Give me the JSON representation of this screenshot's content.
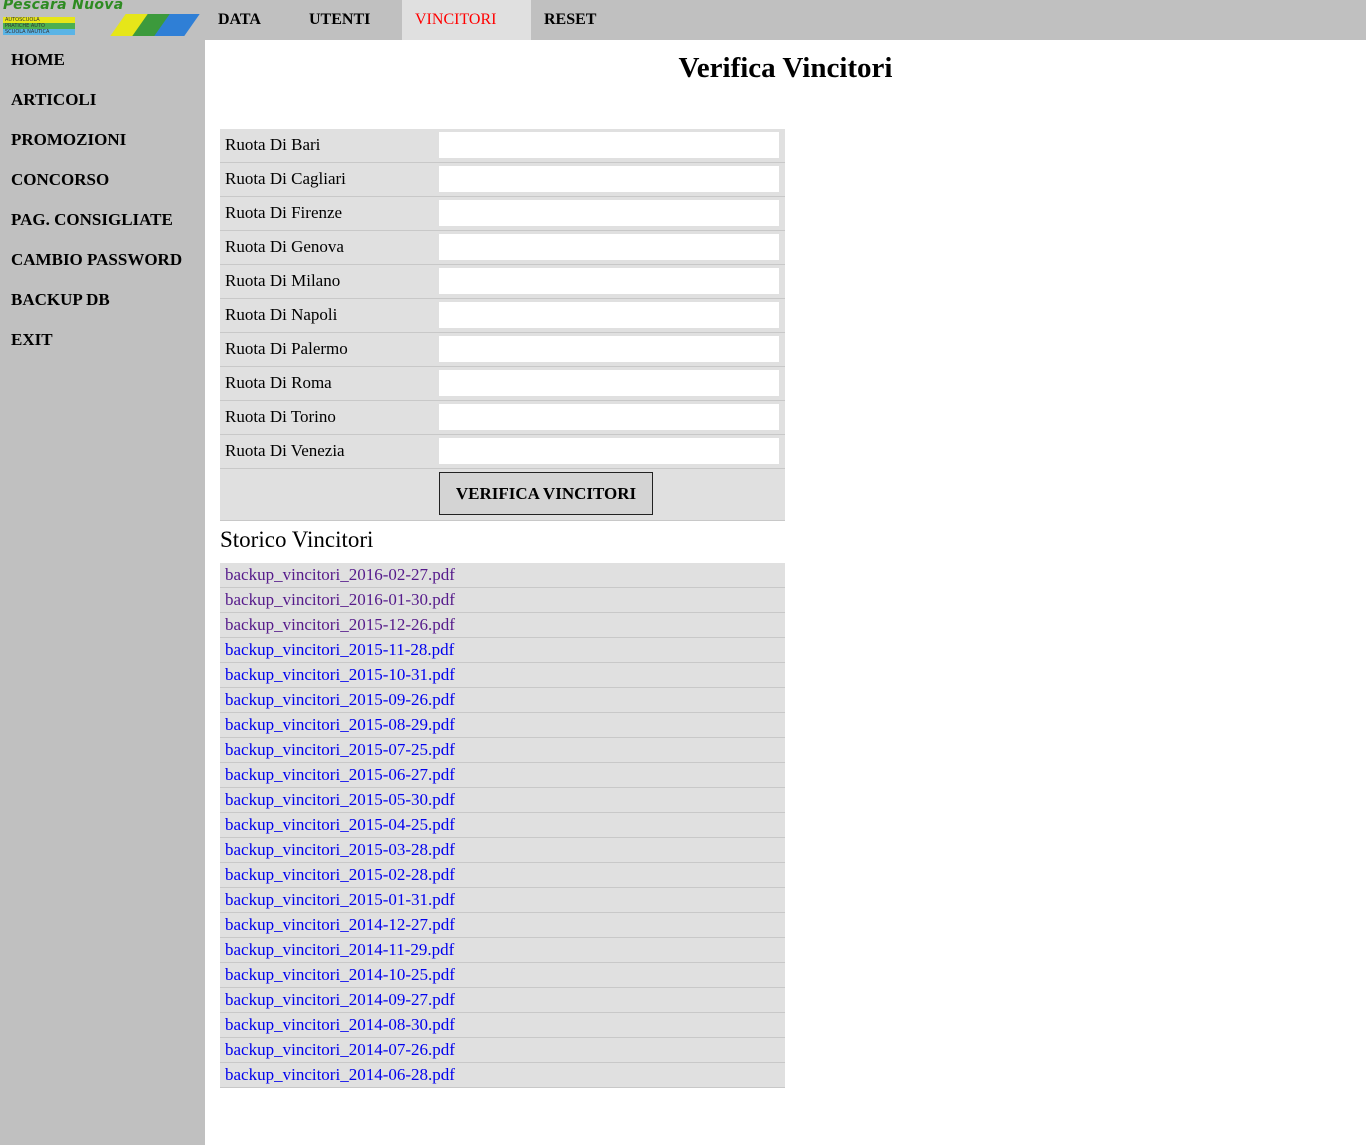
{
  "logo": {
    "title": "Pescara Nuova",
    "sub1": "AUTOSCUOLA",
    "sub2": "PRATICHE AUTO",
    "sub3": "SCUOLA NAUTICA"
  },
  "topnav": {
    "tabs": [
      {
        "label": "DATA"
      },
      {
        "label": "UTENTI"
      },
      {
        "label": "VINCITORI",
        "active": true,
        "color": "#ff0000"
      },
      {
        "label": "RESET"
      }
    ]
  },
  "sidebar": {
    "items": [
      {
        "label": "HOME"
      },
      {
        "label": "ARTICOLI"
      },
      {
        "label": "PROMOZIONI"
      },
      {
        "label": "CONCORSO"
      },
      {
        "label": "PAG. CONSIGLIATE"
      },
      {
        "label": "CAMBIO PASSWORD"
      },
      {
        "label": "BACKUP DB"
      },
      {
        "label": "EXIT"
      }
    ]
  },
  "main": {
    "title": "Verifica Vincitori",
    "form": {
      "rows": [
        {
          "label": "Ruota Di Bari",
          "value": ""
        },
        {
          "label": "Ruota Di Cagliari",
          "value": ""
        },
        {
          "label": "Ruota Di Firenze",
          "value": ""
        },
        {
          "label": "Ruota Di Genova",
          "value": ""
        },
        {
          "label": "Ruota Di Milano",
          "value": ""
        },
        {
          "label": "Ruota Di Napoli",
          "value": ""
        },
        {
          "label": "Ruota Di Palermo",
          "value": ""
        },
        {
          "label": "Ruota Di Roma",
          "value": ""
        },
        {
          "label": "Ruota Di Torino",
          "value": ""
        },
        {
          "label": "Ruota Di Venezia",
          "value": ""
        }
      ],
      "submit_label": "VERIFICA VINCITORI"
    },
    "history": {
      "title": "Storico Vincitori",
      "files": [
        {
          "name": "backup_vincitori_2016-02-27.pdf",
          "visited": true
        },
        {
          "name": "backup_vincitori_2016-01-30.pdf",
          "visited": true
        },
        {
          "name": "backup_vincitori_2015-12-26.pdf",
          "visited": true
        },
        {
          "name": "backup_vincitori_2015-11-28.pdf",
          "visited": false
        },
        {
          "name": "backup_vincitori_2015-10-31.pdf",
          "visited": false
        },
        {
          "name": "backup_vincitori_2015-09-26.pdf",
          "visited": false
        },
        {
          "name": "backup_vincitori_2015-08-29.pdf",
          "visited": false
        },
        {
          "name": "backup_vincitori_2015-07-25.pdf",
          "visited": false
        },
        {
          "name": "backup_vincitori_2015-06-27.pdf",
          "visited": false
        },
        {
          "name": "backup_vincitori_2015-05-30.pdf",
          "visited": false
        },
        {
          "name": "backup_vincitori_2015-04-25.pdf",
          "visited": false
        },
        {
          "name": "backup_vincitori_2015-03-28.pdf",
          "visited": false
        },
        {
          "name": "backup_vincitori_2015-02-28.pdf",
          "visited": false
        },
        {
          "name": "backup_vincitori_2015-01-31.pdf",
          "visited": false
        },
        {
          "name": "backup_vincitori_2014-12-27.pdf",
          "visited": false
        },
        {
          "name": "backup_vincitori_2014-11-29.pdf",
          "visited": false
        },
        {
          "name": "backup_vincitori_2014-10-25.pdf",
          "visited": false
        },
        {
          "name": "backup_vincitori_2014-09-27.pdf",
          "visited": false
        },
        {
          "name": "backup_vincitori_2014-08-30.pdf",
          "visited": false
        },
        {
          "name": "backup_vincitori_2014-07-26.pdf",
          "visited": false
        },
        {
          "name": "backup_vincitori_2014-06-28.pdf",
          "visited": false
        }
      ]
    }
  },
  "colors": {
    "chrome_bg": "#c0c0c0",
    "panel_bg": "#e0e0e0",
    "active_tab": "#ff0000",
    "link": "#0000ee",
    "link_visited": "#551a8b"
  }
}
